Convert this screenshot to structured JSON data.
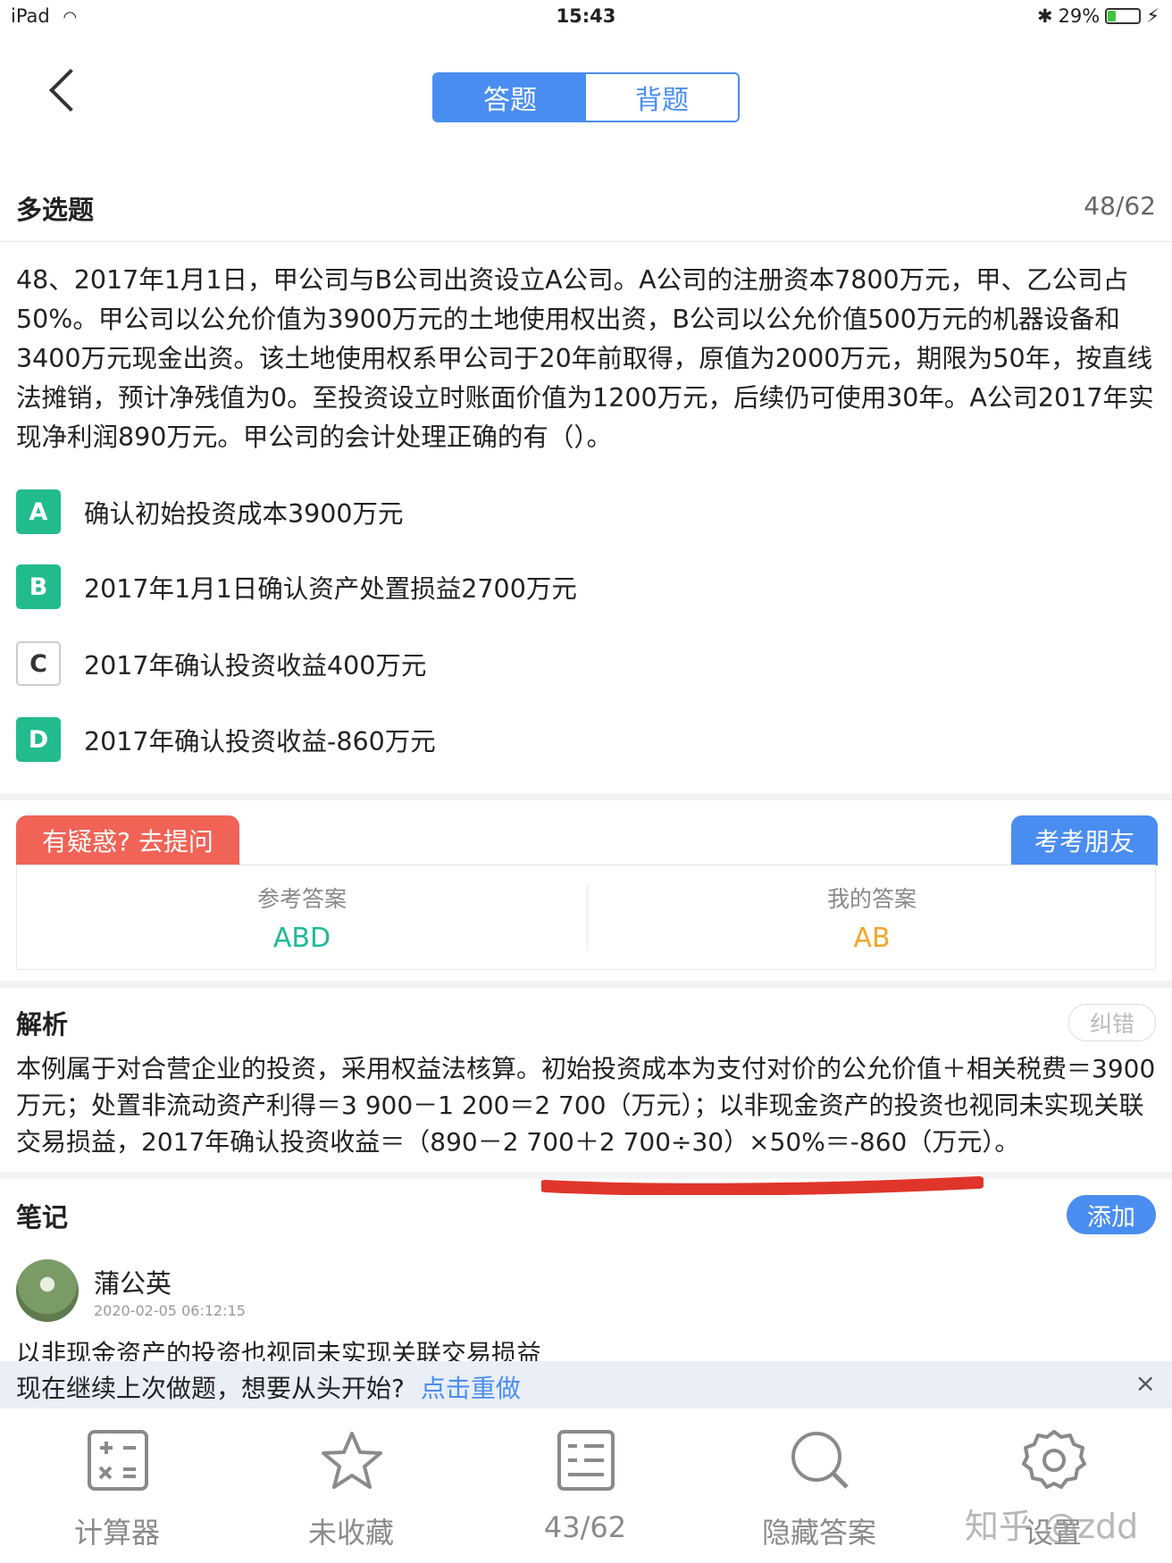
{
  "status_bar": {
    "device": "iPad",
    "time": "15:43",
    "battery": "29%"
  },
  "header": {
    "tabs": [
      "答题",
      "背题"
    ]
  },
  "question": {
    "type": "多选题",
    "counter": "48/62",
    "text": "48、2017年1月1日，甲公司与B公司出资设立A公司。A公司的注册资本7800万元，甲、乙公司占50%。甲公司以公允价值为3900万元的土地使用权出资，B公司以公允价值500万元的机器设备和3400万元现金出资。该土地使用权系甲公司于20年前取得，原值为2000万元，期限为50年，按直线法摊销，预计净残值为0。至投资设立时账面价值为1200万元，后续仍可使用30年。A公司2017年实现净利润890万元。甲公司的会计处理正确的有（）。",
    "options": [
      {
        "letter": "A",
        "text": "确认初始投资成本3900万元",
        "selected": true
      },
      {
        "letter": "B",
        "text": "2017年1月1日确认资产处置损益2700万元",
        "selected": true
      },
      {
        "letter": "C",
        "text": "2017年确认投资收益400万元",
        "selected": false
      },
      {
        "letter": "D",
        "text": "2017年确认投资收益-860万元",
        "selected": true
      }
    ]
  },
  "answers": {
    "ask_label": "有疑惑? 去提问",
    "friend_label": "考考朋友",
    "reference_label": "参考答案",
    "reference_value": "ABD",
    "mine_label": "我的答案",
    "mine_value": "AB",
    "reference_color": "#1fb89a",
    "mine_color": "#f4a52a"
  },
  "analysis": {
    "title": "解析",
    "report_label": "纠错",
    "text": "本例属于对合营企业的投资，采用权益法核算。初始投资成本为支付对价的公允价值＋相关税费＝3900万元；处置非流动资产利得＝3 900－1 200＝2 700（万元）；以非现金资产的投资也视同未实现关联交易损益，2017年确认投资收益＝（890－2 700＋2 700÷30）×50%＝-860（万元）。"
  },
  "notes": {
    "title": "笔记",
    "add_label": "添加",
    "user": "蒲公英",
    "time": "2020-02-05 06:12:15",
    "text": "以非现金资产的投资也视同未实现关联交易损益"
  },
  "resume_banner": {
    "text": "现在继续上次做题，想要从头开始?",
    "link": "点击重做",
    "close": "×"
  },
  "tabbar": [
    {
      "label": "计算器",
      "icon": "calculator-icon"
    },
    {
      "label": "未收藏",
      "icon": "star-icon"
    },
    {
      "label": "43/62",
      "icon": "list-icon"
    },
    {
      "label": "隐藏答案",
      "icon": "search-icon"
    },
    {
      "label": "设置",
      "icon": "gear-icon"
    }
  ],
  "watermark": "知乎 @zdd"
}
